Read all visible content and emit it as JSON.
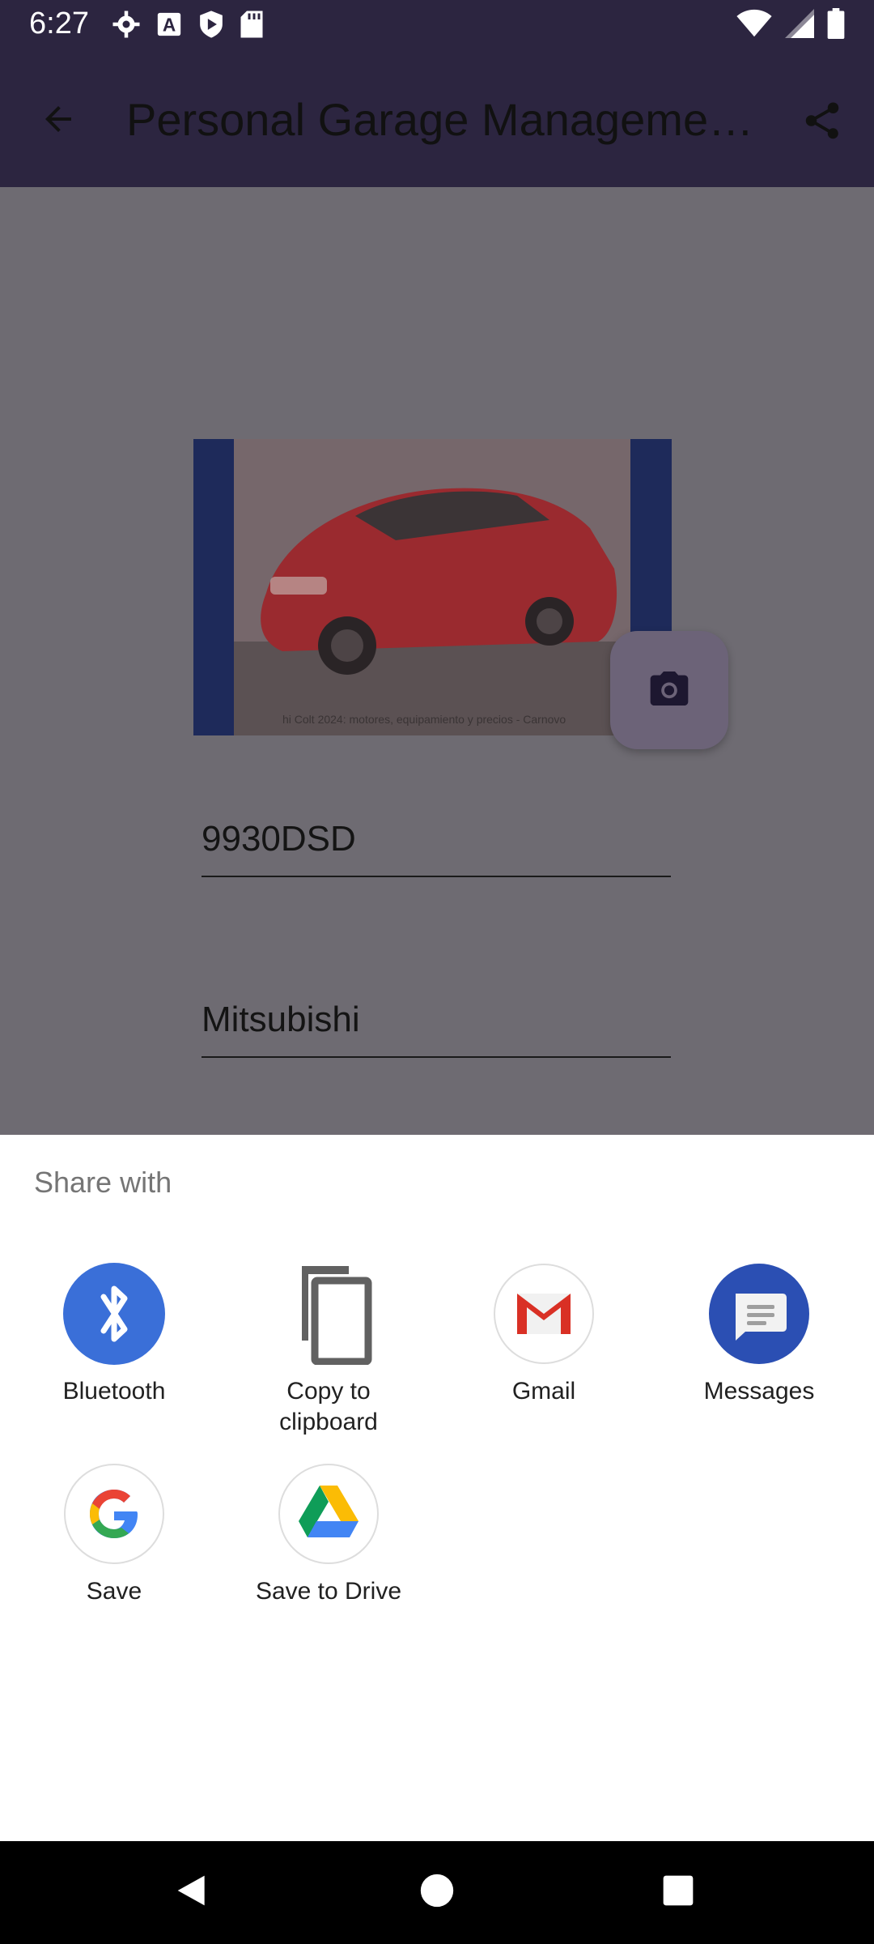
{
  "status_bar": {
    "time": "6:27",
    "left_icons": [
      "settings-icon",
      "a-badge-icon",
      "play-shield-icon",
      "sd-card-icon"
    ],
    "right_icons": [
      "wifi-icon",
      "signal-icon",
      "battery-icon"
    ]
  },
  "app_bar": {
    "title": "Personal Garage Manageme…",
    "back_icon": "arrow-left-icon",
    "share_icon": "share-icon",
    "background": "#2c2540"
  },
  "content": {
    "photo_caption": "hi Colt 2024: motores, equipamiento y precios - Carnovo",
    "plate_field": "9930DSD",
    "make_field": "Mitsubishi",
    "camera_icon": "camera-icon"
  },
  "share_sheet": {
    "title": "Share with",
    "targets": [
      {
        "label": "Bluetooth",
        "icon": "bluetooth-icon",
        "color": "#3a6fd8"
      },
      {
        "label": "Copy to clipboard",
        "icon": "copy-icon",
        "color": "#616161"
      },
      {
        "label": "Gmail",
        "icon": "gmail-icon",
        "color": "#d93025"
      },
      {
        "label": "Messages",
        "icon": "messages-icon",
        "color": "#2b4fb3"
      },
      {
        "label": "Save",
        "icon": "google-icon",
        "color": "#4285f4"
      },
      {
        "label": "Save to Drive",
        "icon": "drive-icon",
        "color": "#0f9d58"
      }
    ]
  },
  "nav_bar": {
    "buttons": [
      "back-triangle-icon",
      "home-circle-icon",
      "recents-square-icon"
    ]
  }
}
